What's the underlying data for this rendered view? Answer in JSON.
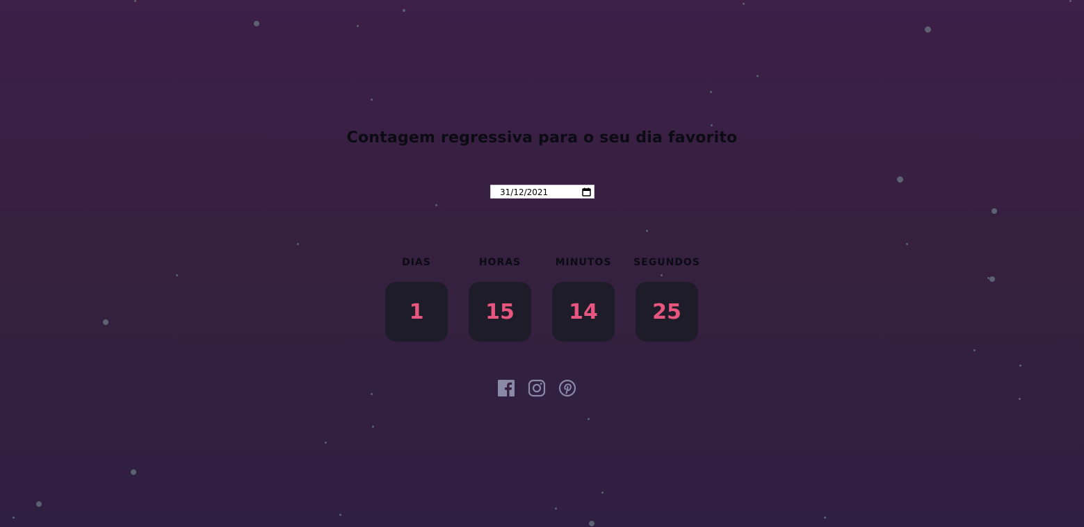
{
  "title": "Contagem regressiva para o seu dia favorito",
  "date_input": {
    "value": "31/12/2021"
  },
  "countdown": [
    {
      "label": "DIAS",
      "value": "1"
    },
    {
      "label": "HORAS",
      "value": "15"
    },
    {
      "label": "MINUTOS",
      "value": "14"
    },
    {
      "label": "SEGUNDOS",
      "value": "25"
    }
  ],
  "social_icons": [
    "facebook-icon",
    "instagram-icon",
    "pinterest-icon"
  ],
  "colors": {
    "background_top": "#3d1f48",
    "background_bottom": "#2f1f40",
    "number": "#e7567f",
    "box": "#1d1c28",
    "icons": "#8a8aa8",
    "star": "#5d6272"
  }
}
